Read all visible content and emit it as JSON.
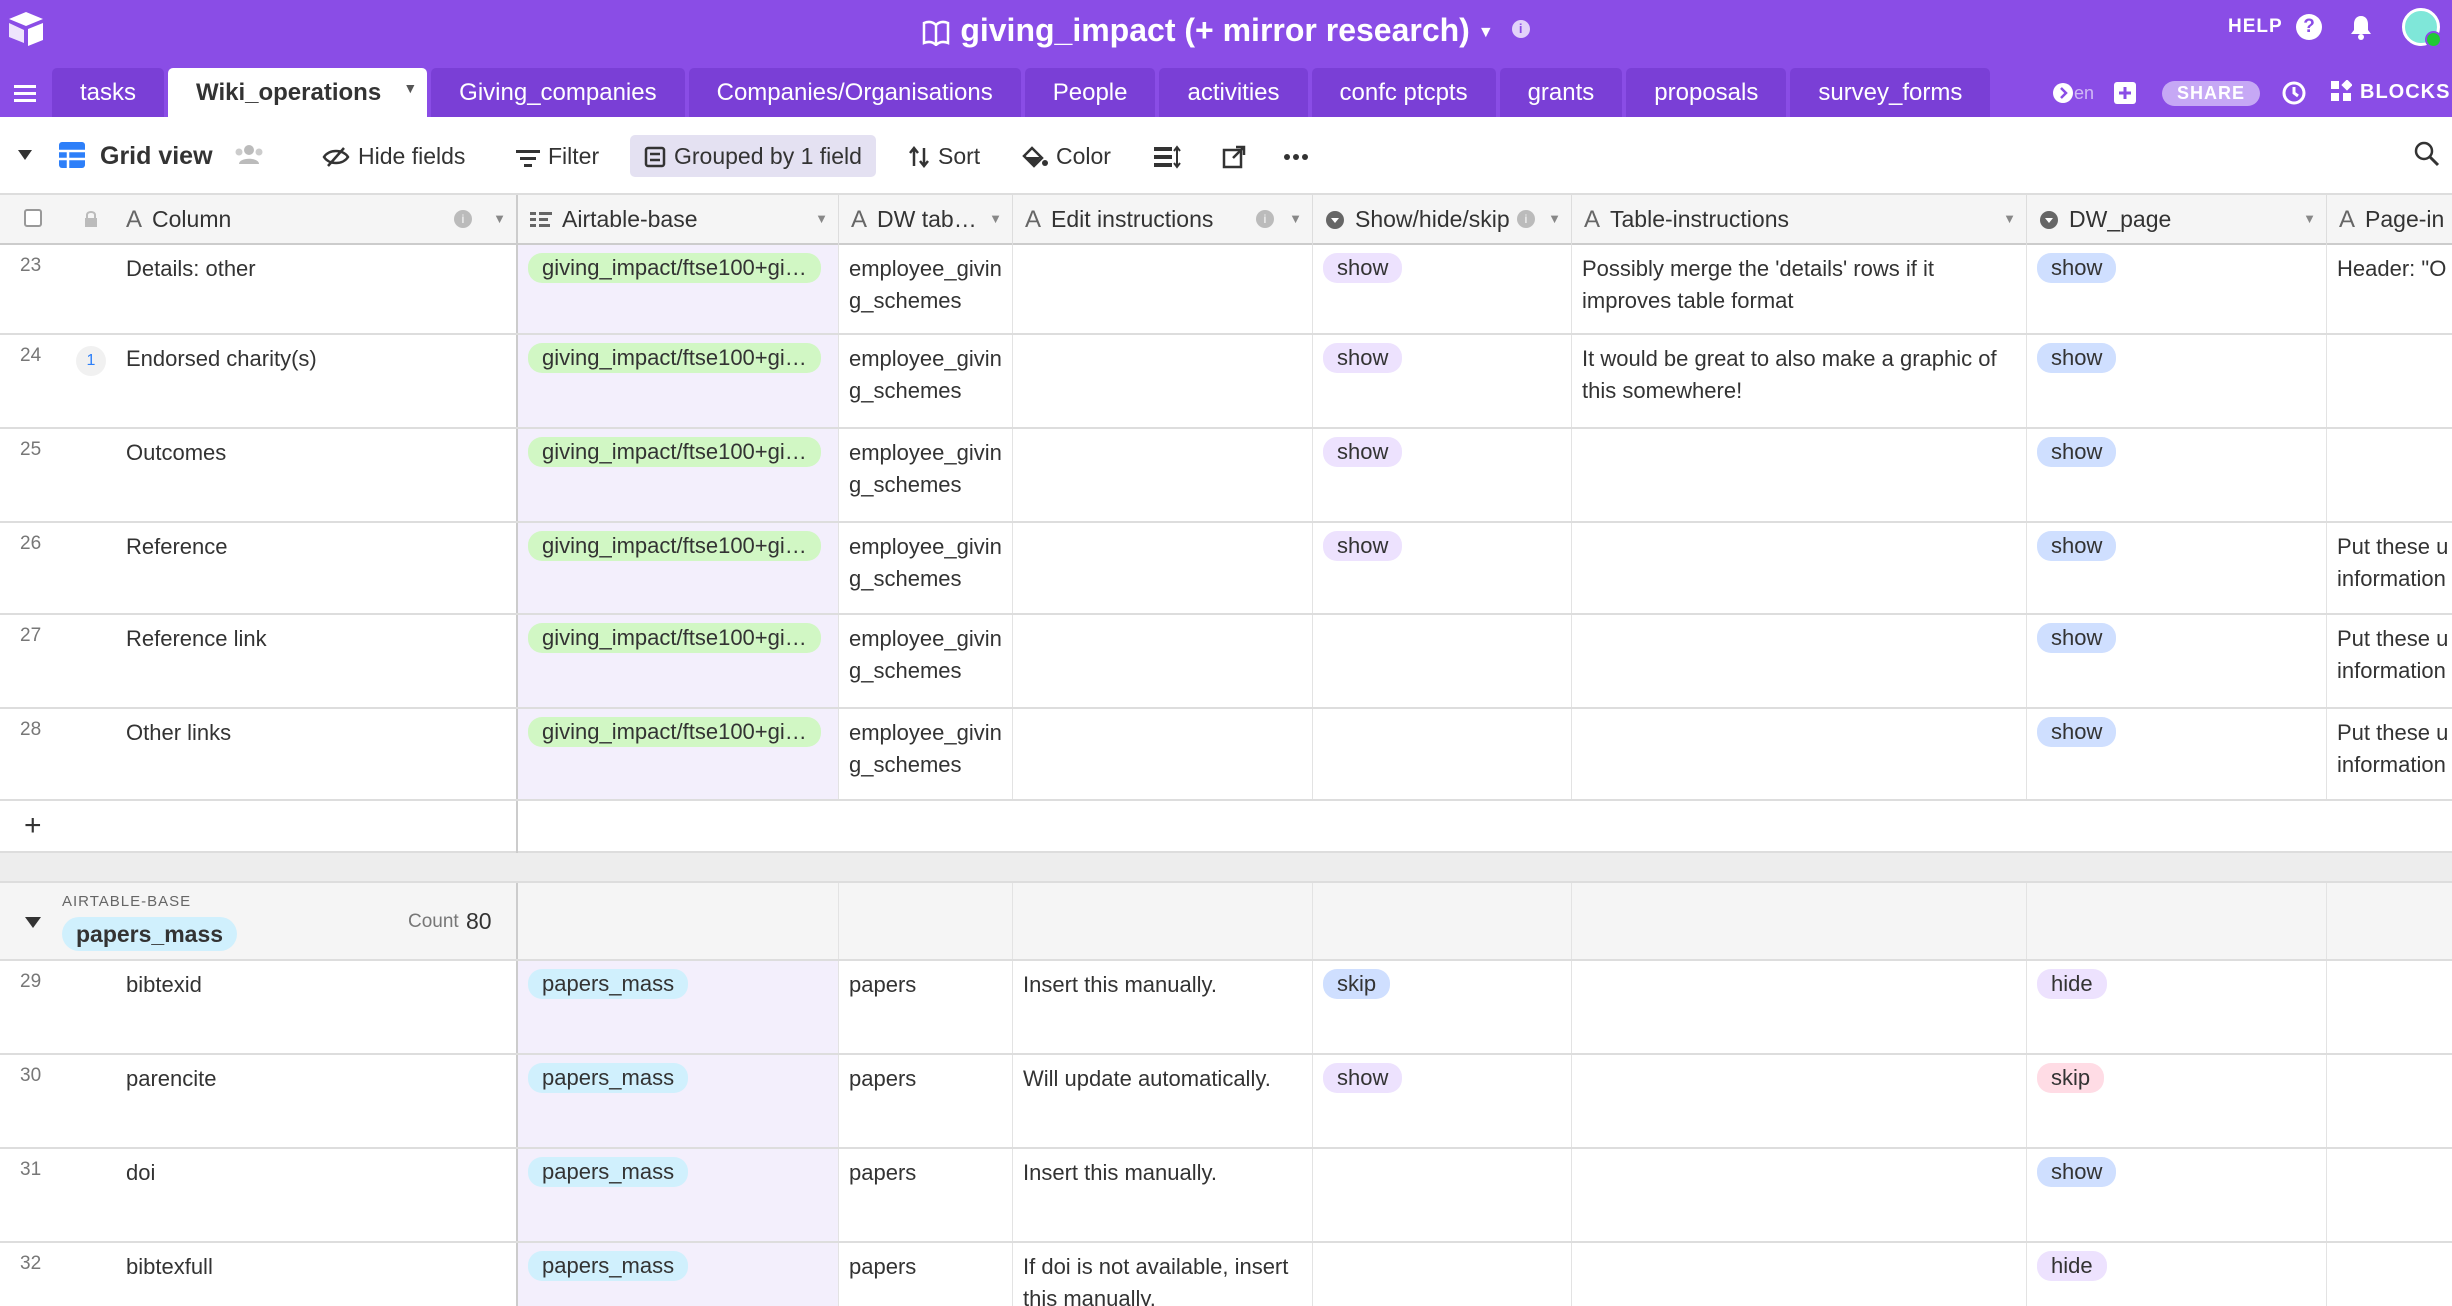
{
  "app": {
    "base_title": "giving_impact (+ mirror research)",
    "info": "i",
    "help": "HELP",
    "help_icon": "?",
    "share": "SHARE",
    "blocks": "BLOCKS",
    "more_tables": "en"
  },
  "tabs": [
    {
      "label": "tasks",
      "active": false
    },
    {
      "label": "Wiki_operations",
      "active": true
    },
    {
      "label": "Giving_companies",
      "active": false
    },
    {
      "label": "Companies/Organisations",
      "active": false
    },
    {
      "label": "People",
      "active": false
    },
    {
      "label": "activities",
      "active": false
    },
    {
      "label": "confc ptcpts",
      "active": false
    },
    {
      "label": "grants",
      "active": false
    },
    {
      "label": "proposals",
      "active": false
    },
    {
      "label": "survey_forms",
      "active": false
    }
  ],
  "toolbar": {
    "view_name": "Grid view",
    "hide_fields": "Hide fields",
    "filter": "Filter",
    "grouped": "Grouped by 1 field",
    "sort": "Sort",
    "color": "Color"
  },
  "columns": [
    {
      "label": "Column",
      "type": "text"
    },
    {
      "label": "Airtable-base",
      "type": "link"
    },
    {
      "label": "DW tab…",
      "type": "text"
    },
    {
      "label": "Edit instructions",
      "type": "text"
    },
    {
      "label": "Show/hide/skip",
      "type": "select"
    },
    {
      "label": "Table-instructions",
      "type": "text"
    },
    {
      "label": "DW_page",
      "type": "select"
    },
    {
      "label": "Page-in",
      "type": "text"
    }
  ],
  "rows_group1": [
    {
      "num": "23",
      "column": "Details: other",
      "base": "giving_impact/ftse100+gi…",
      "dw_tab": "employee_giving_schemes",
      "edit": "",
      "show": "show",
      "table_instr": "Possibly merge the 'details' rows if it improves table format",
      "dw_page": "show",
      "page_in": "Header: \"O"
    },
    {
      "num": "24",
      "column": "Endorsed charity(s)",
      "base": "giving_impact/ftse100+gi…",
      "dw_tab": "employee_giving_schemes",
      "edit": "",
      "show": "show",
      "table_instr": "It would be great to also make a graphic of this somewhere!",
      "dw_page": "show",
      "page_in": "",
      "comments": "1"
    },
    {
      "num": "25",
      "column": "Outcomes",
      "base": "giving_impact/ftse100+gi…",
      "dw_tab": "employee_giving_schemes",
      "edit": "",
      "show": "show",
      "table_instr": "",
      "dw_page": "show",
      "page_in": ""
    },
    {
      "num": "26",
      "column": "Reference",
      "base": "giving_impact/ftse100+gi…",
      "dw_tab": "employee_giving_schemes",
      "edit": "",
      "show": "show",
      "table_instr": "",
      "dw_page": "show",
      "page_in": "Put these u information"
    },
    {
      "num": "27",
      "column": "Reference link",
      "base": "giving_impact/ftse100+gi…",
      "dw_tab": "employee_giving_schemes",
      "edit": "",
      "show": "",
      "table_instr": "",
      "dw_page": "show",
      "page_in": "Put these u information"
    },
    {
      "num": "28",
      "column": "Other links",
      "base": "giving_impact/ftse100+gi…",
      "dw_tab": "employee_giving_schemes",
      "edit": "",
      "show": "",
      "table_instr": "",
      "dw_page": "show",
      "page_in": "Put these u information"
    }
  ],
  "add_row": "+",
  "group2": {
    "field": "AIRTABLE-BASE",
    "value": "papers_mass",
    "count_label": "Count",
    "count": "80"
  },
  "rows_group2": [
    {
      "num": "29",
      "column": "bibtexid",
      "base": "papers_mass",
      "dw_tab": "papers",
      "edit": "Insert this manually.",
      "show": "skip",
      "table_instr": "",
      "dw_page": "hide",
      "page_in": ""
    },
    {
      "num": "30",
      "column": "parencite",
      "base": "papers_mass",
      "dw_tab": "papers",
      "edit": "Will update automatically.",
      "show": "show",
      "table_instr": "",
      "dw_page": "skip",
      "page_in": ""
    },
    {
      "num": "31",
      "column": "doi",
      "base": "papers_mass",
      "dw_tab": "papers",
      "edit": "Insert this manually.",
      "show": "",
      "table_instr": "",
      "dw_page": "show",
      "page_in": ""
    },
    {
      "num": "32",
      "column": "bibtexfull",
      "base": "papers_mass",
      "dw_tab": "papers",
      "edit": "If doi is not available, insert this manually.",
      "show": "",
      "table_instr": "",
      "dw_page": "hide",
      "page_in": ""
    }
  ],
  "colors": {
    "topbar": "#8a4de6",
    "link_pill_green": "#d1f7c4",
    "link_pill_cyan": "#d0f0fd",
    "show": "#ede2fe",
    "show_dw": "#cfdfff",
    "skip": "#cfdfff",
    "skip_dw": "#ffdce5",
    "hide": "#ede2fe"
  },
  "icons": [
    "airtable-logo-icon",
    "book-icon",
    "bell-icon",
    "menu-icon",
    "grid-icon",
    "search-icon",
    "history-icon",
    "blocks-icon"
  ]
}
